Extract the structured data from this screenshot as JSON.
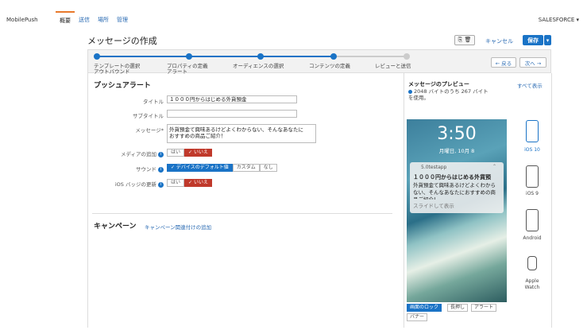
{
  "app": {
    "brand": "MobilePush",
    "account": "SALESFORCE ▾"
  },
  "nav": {
    "tabs": [
      {
        "label": "概要",
        "active": true
      },
      {
        "label": "送信"
      },
      {
        "label": "場所"
      },
      {
        "label": "管理"
      }
    ]
  },
  "header": {
    "title": "メッセージの作成",
    "copy_label": "⎘ 🗑",
    "cancel_label": "キャンセル",
    "save_label": "保存",
    "save_dd": "▾"
  },
  "wizard": {
    "steps": [
      "テンプレートの選択\nアウトバウンド",
      "プロパティの定義\nアラート",
      "オーディエンスの選択",
      "コンテンツの定義",
      "レビューと送信"
    ],
    "back_label": "← 戻る",
    "next_label": "次へ →"
  },
  "form": {
    "section_title": "プッシュアラート",
    "title_label": "タイトル",
    "title_value": "１０００円からはじめる外貨預金",
    "subtitle_label": "サブタイトル",
    "subtitle_value": "",
    "message_label": "メッセージ*",
    "message_value": "外貨預金て興味あるけどよくわからない、そんなあなたに\nおすすめの商品ご紹介！",
    "media_label": "メディアの追加",
    "media_options": [
      "はい",
      "✓ いいえ"
    ],
    "sound_label": "サウンド",
    "sound_options": [
      "✓ デバイスのデフォルト値",
      "カスタム",
      "なし"
    ],
    "badge_label": "iOS バッジの更新",
    "badge_options": [
      "はい",
      "✓ いいえ"
    ],
    "info_icon": "i"
  },
  "campaign": {
    "title": "キャンペーン",
    "link": "キャンペーン関連付けの追加"
  },
  "preview": {
    "title": "メッセージのプレビュー",
    "show_all": "すべて表示",
    "bytes": "2048 バイトのうち 267 バイト\nを使用。",
    "time": "3:50",
    "date": "月曜日, 10月 8",
    "app_name": "5.0testapp",
    "notif_title": "１０００円からはじめる外貨預",
    "notif_body": "外貨預金て興味あるけどよくわから\nない、そんなあなたにおすすめの商\n品ご紹介！",
    "slide": "スライドして表示",
    "devices": [
      "iOS 10",
      "iOS 9",
      "Android",
      "Apple\nWatch"
    ],
    "tabs": [
      "画面のロック",
      "長押し",
      "アラート",
      "バナー"
    ]
  }
}
